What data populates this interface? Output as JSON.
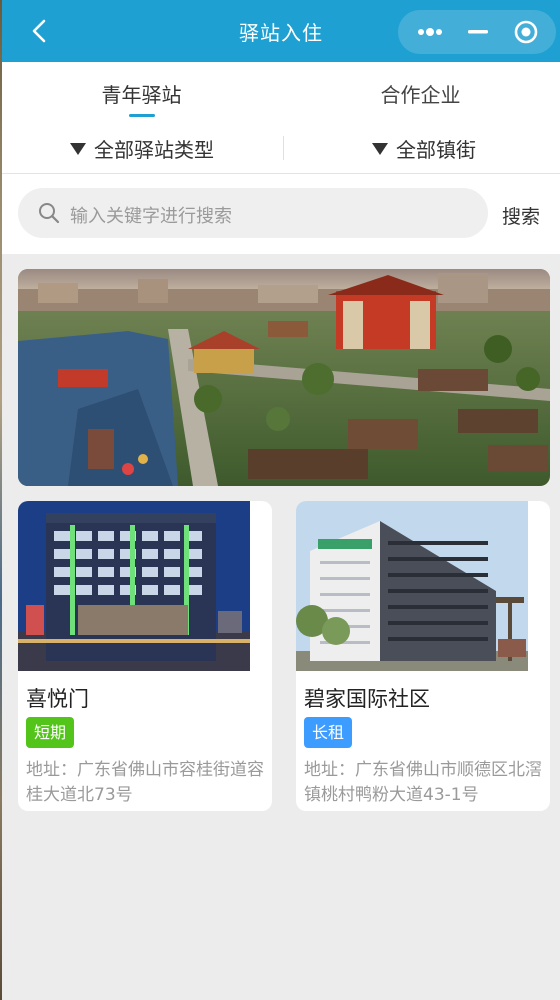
{
  "navbar": {
    "title": "驿站入住"
  },
  "tabs": [
    {
      "label": "青年驿站",
      "active": true
    },
    {
      "label": "合作企业",
      "active": false
    }
  ],
  "filters": [
    {
      "label": "全部驿站类型"
    },
    {
      "label": "全部镇街"
    }
  ],
  "search": {
    "placeholder": "输入关键字进行搜索",
    "button_label": "搜索"
  },
  "cards": [
    {
      "name": "喜悦门",
      "badge": "短期",
      "badge_color": "#52c41a",
      "address": "地址：广东省佛山市容桂街道容桂大道北73号"
    },
    {
      "name": "碧家国际社区",
      "badge": "长租",
      "badge_color": "#3d9cff",
      "address": "地址：广东省佛山市顺德区北滘镇桃村鸭粉大道43-1号"
    }
  ],
  "colors": {
    "primary": "#1fa0d2",
    "background": "#ececec"
  }
}
